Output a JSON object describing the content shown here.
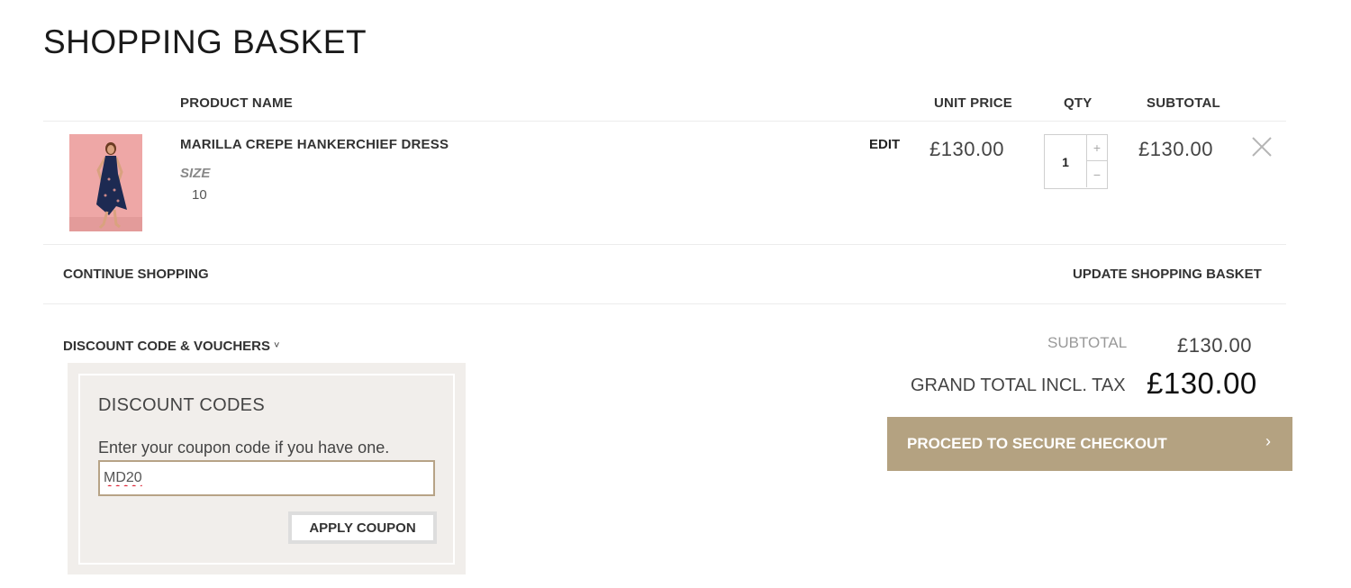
{
  "page": {
    "title": "SHOPPING BASKET"
  },
  "table": {
    "headers": {
      "product_name": "PRODUCT NAME",
      "unit_price": "UNIT PRICE",
      "qty": "QTY",
      "subtotal": "SUBTOTAL"
    }
  },
  "items": [
    {
      "name": "MARILLA CREPE HANKERCHIEF DRESS",
      "option_label": "SIZE",
      "option_value": "10",
      "edit_label": "EDIT",
      "unit_price": "£130.00",
      "qty": "1",
      "qty_plus": "+",
      "qty_minus": "−",
      "subtotal": "£130.00"
    }
  ],
  "actions": {
    "continue": "CONTINUE SHOPPING",
    "update": "UPDATE SHOPPING BASKET"
  },
  "discount": {
    "toggle_label": "DISCOUNT CODE & VOUCHERS",
    "toggle_chevron": "˅",
    "title": "DISCOUNT CODES",
    "help": "Enter your coupon code if you have one.",
    "code_value": "MD20",
    "apply_label": "APPLY COUPON"
  },
  "totals": {
    "subtotal_label": "SUBTOTAL",
    "subtotal_value": "£130.00",
    "grand_label": "GRAND TOTAL INCL. TAX",
    "grand_value": "£130.00"
  },
  "checkout": {
    "label": "PROCEED TO SECURE CHECKOUT",
    "arrow": "›"
  },
  "colors": {
    "accent": "#b4a281",
    "panel_bg": "#f1eeeb",
    "input_border": "#b7a386",
    "product_bg": "#eea7a6",
    "dress": "#1d2a52"
  },
  "icons": {
    "remove": "close-icon",
    "qty_up": "plus-icon",
    "qty_down": "minus-icon",
    "expand": "chevron-down-icon",
    "checkout": "chevron-right-icon"
  }
}
